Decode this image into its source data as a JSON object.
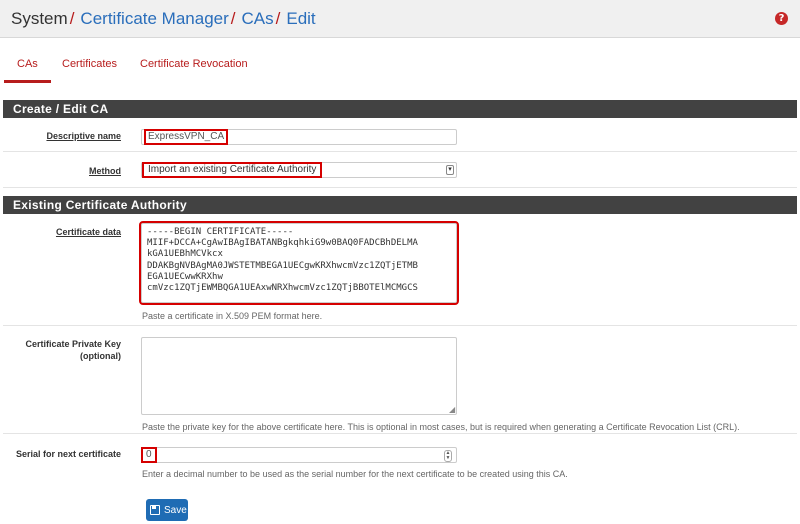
{
  "breadcrumb": {
    "root": "System",
    "items": [
      "Certificate Manager",
      "CAs",
      "Edit"
    ],
    "separator": "/"
  },
  "help_icon": "question-circle-icon",
  "tabs": [
    {
      "label": "CAs",
      "active": true
    },
    {
      "label": "Certificates",
      "active": false
    },
    {
      "label": "Certificate Revocation",
      "active": false
    }
  ],
  "section_create": {
    "title": "Create / Edit CA",
    "descriptive_name": {
      "label": "Descriptive name",
      "value": "ExpressVPN_CA"
    },
    "method": {
      "label": "Method",
      "value": "Import an existing Certificate Authority"
    }
  },
  "section_existing": {
    "title": "Existing Certificate Authority",
    "certificate_data": {
      "label": "Certificate data",
      "value": "-----BEGIN CERTIFICATE-----\nMIIF+DCCA+CgAwIBAgIBATANBgkqhkiG9w0BAQ0FADCBhDELMA\nkGA1UEBhMCVkcx\nDDAKBgNVBAgMA0JWSTETMBEGA1UECgwKRXhwcmVzc1ZQTjETMB\nEGA1UECwwKRXhw\ncmVzc1ZQTjEWMBQGA1UEAxwNRXhwcmVzc1ZQTjBBOTElMCMGCS",
      "help": "Paste a certificate in X.509 PEM format here."
    },
    "private_key": {
      "label_line1": "Certificate Private Key",
      "label_line2": "(optional)",
      "value": "",
      "help": "Paste the private key for the above certificate here. This is optional in most cases, but is required when generating a Certificate Revocation List (CRL)."
    },
    "serial": {
      "label": "Serial for next certificate",
      "value": "0",
      "help": "Enter a decimal number to be used as the serial number for the next certificate to be created using this CA."
    }
  },
  "save_button": {
    "label": "Save",
    "icon": "save-icon"
  },
  "colors": {
    "accent": "#b71c1c",
    "link": "#2a6ebb",
    "section": "#424242",
    "button": "#1f6cb4",
    "highlight": "#d50000"
  }
}
